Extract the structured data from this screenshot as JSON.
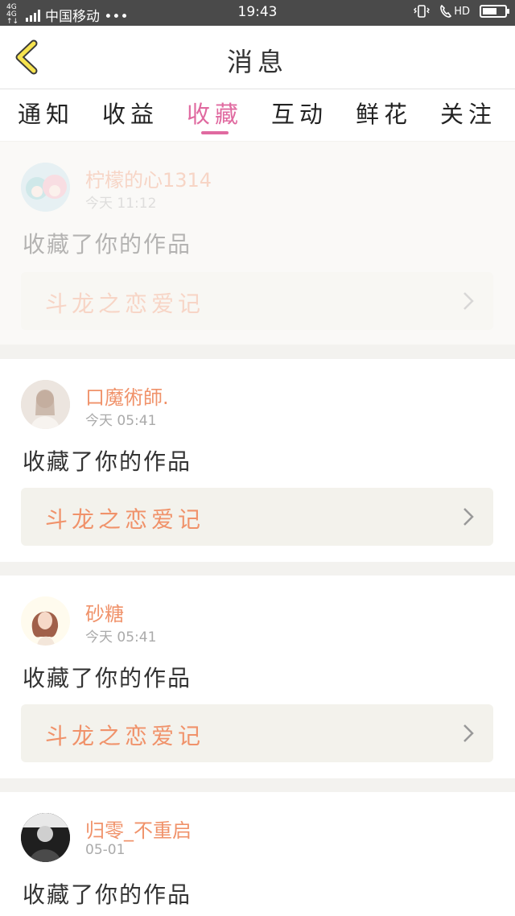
{
  "status_bar": {
    "network_top": "4G 4G",
    "network_bottom": "↑↓",
    "carrier": "中国移动 •••",
    "time": "19:43",
    "hd": "HD",
    "battery_level": 0.65
  },
  "header": {
    "title": "消息",
    "back_icon": "chevron-left-icon"
  },
  "tabs": [
    {
      "label": "通知",
      "active": false
    },
    {
      "label": "收益",
      "active": false
    },
    {
      "label": "收藏",
      "active": true
    },
    {
      "label": "互动",
      "active": false
    },
    {
      "label": "鲜花",
      "active": false
    },
    {
      "label": "关注",
      "active": false
    }
  ],
  "messages": [
    {
      "username": "柠檬的心1314",
      "time": "今天 11:12",
      "action": "收藏了你的作品",
      "work_title": "斗龙之恋爱记",
      "read": true
    },
    {
      "username": "口魔術師.",
      "time": "今天 05:41",
      "action": "收藏了你的作品",
      "work_title": "斗龙之恋爱记",
      "read": false
    },
    {
      "username": "砂糖",
      "time": "今天 05:41",
      "action": "收藏了你的作品",
      "work_title": "斗龙之恋爱记",
      "read": false
    },
    {
      "username": "归零_不重启",
      "time": "05-01",
      "action": "收藏了你的作品",
      "work_title": "",
      "read": false
    }
  ],
  "colors": {
    "accent_tab": "#e06aa0",
    "username": "#f0926a",
    "work_title": "#f0926a"
  }
}
